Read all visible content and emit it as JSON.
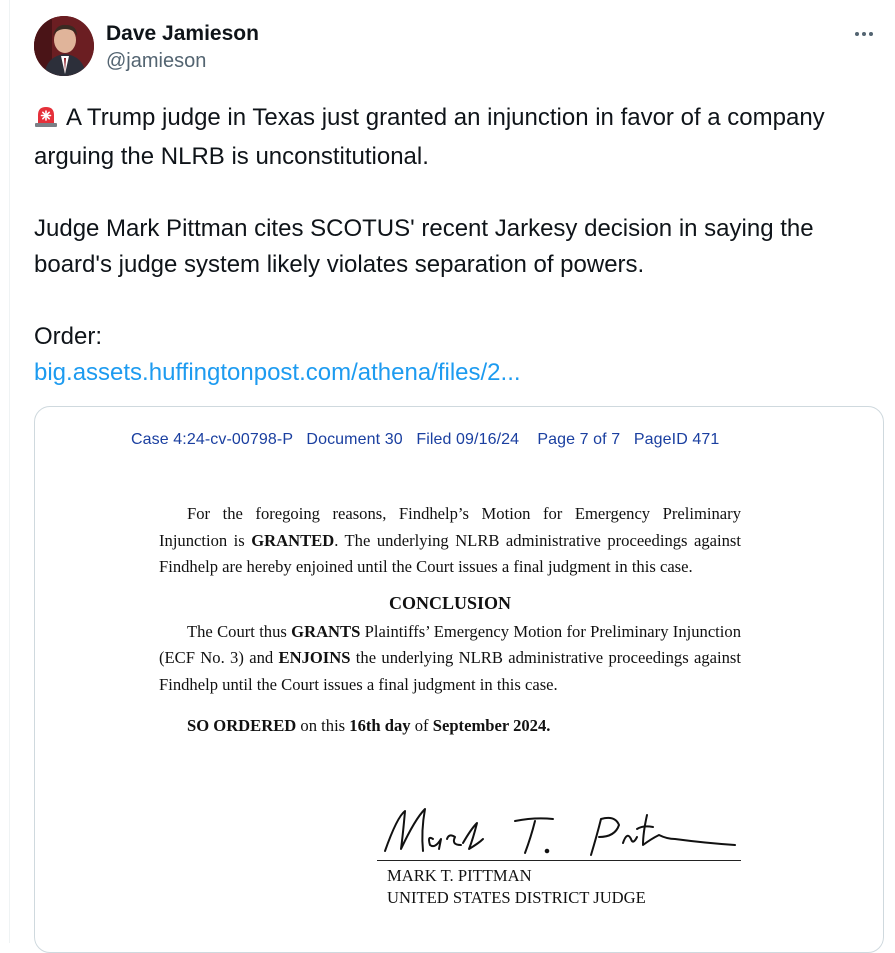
{
  "author": {
    "display_name": "Dave Jamieson",
    "handle": "@jamieson"
  },
  "tweet": {
    "line1": "A Trump judge in Texas just granted an injunction in favor of a company arguing the NLRB is unconstitutional.",
    "line2": "Judge Mark Pittman cites SCOTUS' recent Jarkesy decision in saying the board's judge system likely violates separation of powers.",
    "line3": "Order:",
    "link_text": "big.assets.huffingtonpost.com/athena/files/2...",
    "emoji": "siren-icon"
  },
  "document": {
    "header": "Case 4:24-cv-00798-P   Document 30   Filed 09/16/24    Page 7 of 7   PageID 471",
    "para1_a": "For the foregoing reasons, Findhelp’s Motion for Emergency Preliminary Injunction is ",
    "para1_bold": "GRANTED",
    "para1_b": ". The underlying NLRB administrative proceedings against Findhelp are hereby enjoined until the Court issues a final judgment in this case.",
    "conclusion_heading": "CONCLUSION",
    "para2_a": "The Court thus ",
    "para2_bold1": "GRANTS",
    "para2_b": " Plaintiffs’ Emergency Motion for Preliminary Injunction (ECF No. 3) and ",
    "para2_bold2": "ENJOINS",
    "para2_c": " the underlying NLRB administrative proceedings against Findhelp until the Court issues a final judgment in this case.",
    "so_ordered_bold": "SO ORDERED",
    "so_ordered_mid": " on this ",
    "so_ordered_day": "16th day",
    "so_ordered_of": " of ",
    "so_ordered_date": "September 2024.",
    "signer_name": "MARK T. PITTMAN",
    "signer_title": "UNITED STATES DISTRICT JUDGE"
  },
  "colors": {
    "link": "#1d9bf0",
    "doc_header": "#1a3fa0",
    "secondary_text": "#536471"
  }
}
